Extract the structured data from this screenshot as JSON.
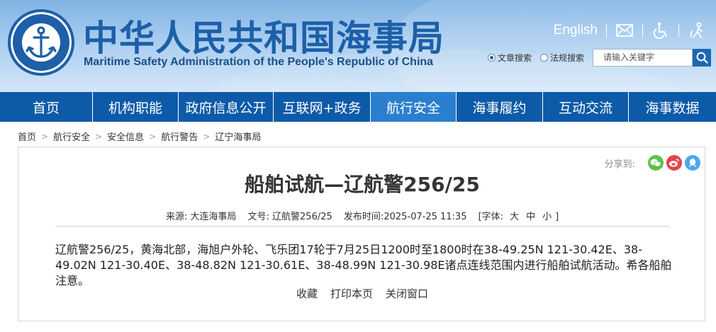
{
  "header": {
    "title_cn": "中华人民共和国海事局",
    "title_en": "Maritime Safety Administration of the People's Republic of China",
    "logo_text_cn": "中国海事局",
    "logo_text_en": "CHINA MSA",
    "english_link": "English",
    "icons": [
      "mail-icon",
      "accessibility-icon",
      "elder-care-icon"
    ]
  },
  "search": {
    "options": [
      "文章搜索",
      "法规搜索"
    ],
    "selected": "文章搜索",
    "placeholder": "请输入关键字"
  },
  "nav": {
    "items": [
      "首页",
      "机构职能",
      "政府信息公开",
      "互联网+政务",
      "航行安全",
      "海事履约",
      "互动交流",
      "海事数据"
    ],
    "active": "航行安全"
  },
  "breadcrumb": [
    "首页",
    "航行安全",
    "安全信息",
    "航行警告",
    "辽宁海事局"
  ],
  "article": {
    "share_label": "分享到:",
    "title": "船舶试航—辽航警256/25",
    "source_label": "来源:",
    "source": "大连海事局",
    "doc_no_label": "文号:",
    "doc_no": "辽航警256/25",
    "date_label": "发布时间:",
    "date": "2025-07-25 11:35",
    "font_size_label": "[字体:",
    "font_sizes": [
      "大",
      "中",
      "小"
    ],
    "font_size_end": "]",
    "body": "辽航警256/25，黄海北部，海旭户外轮、飞乐团17轮于7月25日1200时至1800时在38-49.25N 121-30.42E、38-49.02N 121-30.40E、38-48.82N 121-30.61E、38-48.99N 121-30.98E诸点连线范围内进行船舶试航活动。希各船舶注意。",
    "actions": [
      "收藏",
      "打印本页",
      "关闭窗口"
    ]
  },
  "colors": {
    "nav_bg": "#0d5ba8",
    "nav_active": "#2b7fcf",
    "title_blue": "#1d5fa8",
    "wechat": "#5fc148",
    "weibo": "#e6434a",
    "qq": "#4aa8ec"
  }
}
